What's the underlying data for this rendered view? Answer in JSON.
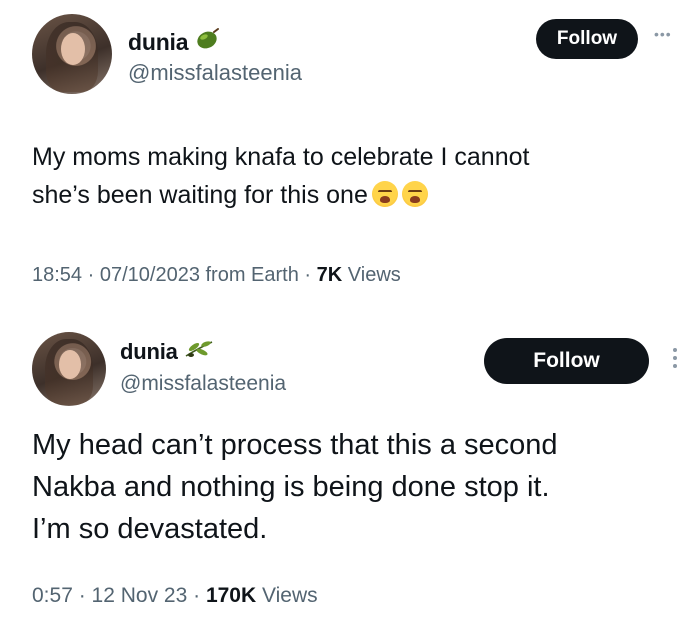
{
  "tweets": [
    {
      "author": {
        "name": "dunia",
        "handle": "@missfalasteenia",
        "badge_icon": "olive-icon"
      },
      "follow_label": "Follow",
      "more_icon": "more-horizontal-icon",
      "text": "My moms making knafa to celebrate I cannot\nshe’s been waiting for this one",
      "emojis": [
        "loudly-crying-face-icon",
        "loudly-crying-face-icon"
      ],
      "meta": {
        "time": "18:54",
        "sep1": " · ",
        "date": "07/10/2023 from Earth",
        "sep2": " · ",
        "views_count": "7K",
        "views_label": " Views"
      }
    },
    {
      "author": {
        "name": "dunia",
        "handle": "@missfalasteenia",
        "badge_icon": "olive-branch-icon"
      },
      "follow_label": "Follow",
      "more_icon": "more-vertical-icon",
      "text": "My head can’t process that this a second\nNakba and nothing is being done stop it.\nI’m so devastated.",
      "meta": {
        "time": "0:57",
        "sep1": " · ",
        "date": "12 Nov 23",
        "sep2": " · ",
        "views_count": "170K",
        "views_label": " Views"
      }
    }
  ],
  "colors": {
    "text": "#0f1419",
    "secondary": "#536471",
    "button_bg": "#0f1419",
    "button_text": "#ffffff",
    "background": "#ffffff"
  }
}
